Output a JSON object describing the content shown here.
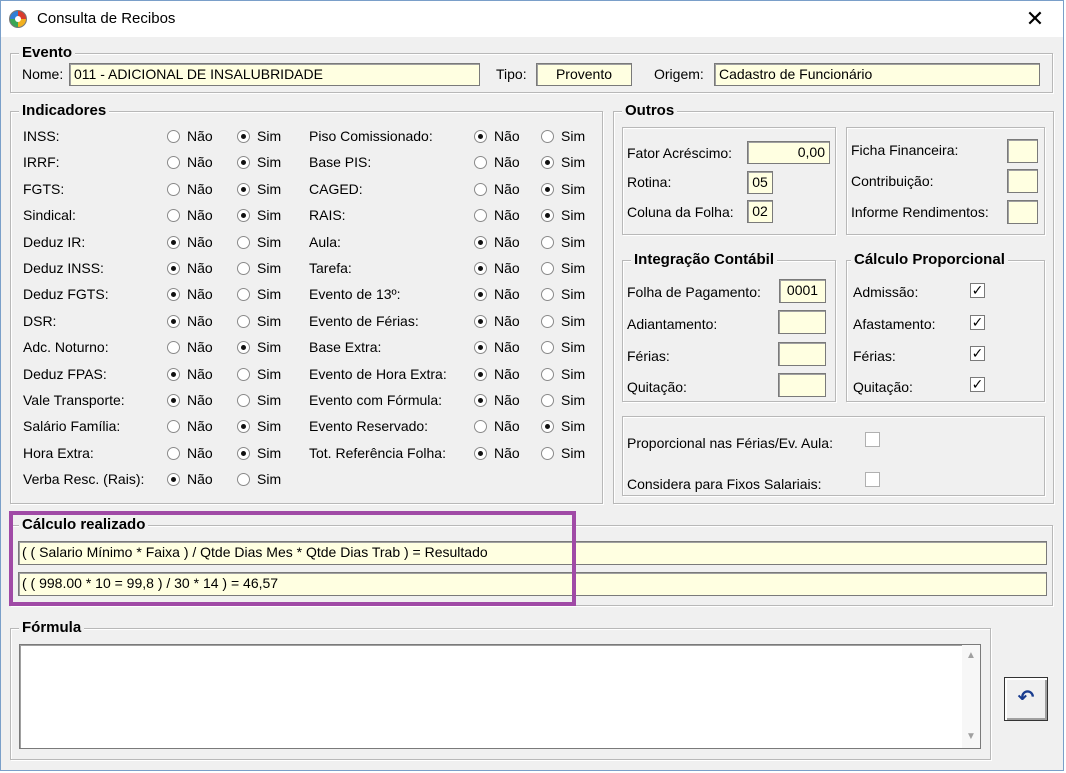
{
  "window": {
    "title": "Consulta de Recibos",
    "close_label": "✕"
  },
  "evento": {
    "legend": "Evento",
    "nome_label": "Nome:",
    "nome_value": "011 - ADICIONAL DE INSALUBRIDADE",
    "tipo_label": "Tipo:",
    "tipo_value": "Provento",
    "origem_label": "Origem:",
    "origem_value": "Cadastro de Funcionário"
  },
  "indicadores": {
    "legend": "Indicadores",
    "nao": "Não",
    "sim": "Sim",
    "left": [
      {
        "label": "INSS:",
        "value": "sim"
      },
      {
        "label": "IRRF:",
        "value": "sim"
      },
      {
        "label": "FGTS:",
        "value": "sim"
      },
      {
        "label": "Sindical:",
        "value": "sim"
      },
      {
        "label": "Deduz IR:",
        "value": "nao"
      },
      {
        "label": "Deduz INSS:",
        "value": "nao"
      },
      {
        "label": "Deduz FGTS:",
        "value": "nao"
      },
      {
        "label": "DSR:",
        "value": "nao"
      },
      {
        "label": "Adc. Noturno:",
        "value": "sim"
      },
      {
        "label": "Deduz FPAS:",
        "value": "nao"
      },
      {
        "label": "Vale Transporte:",
        "value": "nao"
      },
      {
        "label": "Salário Família:",
        "value": "sim"
      },
      {
        "label": "Hora Extra:",
        "value": "sim"
      },
      {
        "label": "Verba Resc. (Rais):",
        "value": "nao"
      }
    ],
    "right": [
      {
        "label": "Piso Comissionado:",
        "value": "nao"
      },
      {
        "label": "Base PIS:",
        "value": "sim"
      },
      {
        "label": "CAGED:",
        "value": "sim"
      },
      {
        "label": "RAIS:",
        "value": "sim"
      },
      {
        "label": "Aula:",
        "value": "nao"
      },
      {
        "label": "Tarefa:",
        "value": "nao"
      },
      {
        "label": "Evento de 13º:",
        "value": "nao"
      },
      {
        "label": "Evento de Férias:",
        "value": "nao"
      },
      {
        "label": "Base Extra:",
        "value": "nao"
      },
      {
        "label": "Evento de Hora Extra:",
        "value": "nao"
      },
      {
        "label": "Evento com Fórmula:",
        "value": "nao"
      },
      {
        "label": "Evento Reservado:",
        "value": "sim"
      },
      {
        "label": "Tot. Referência Folha:",
        "value": "nao"
      }
    ]
  },
  "outros": {
    "legend": "Outros",
    "fator_label": "Fator Acréscimo:",
    "fator_value": "0,00",
    "rotina_label": "Rotina:",
    "rotina_value": "05",
    "coluna_label": "Coluna da Folha:",
    "coluna_value": "02",
    "ficha_label": "Ficha Financeira:",
    "ficha_value": "",
    "contrib_label": "Contribuição:",
    "contrib_value": "",
    "informe_label": "Informe Rendimentos:",
    "informe_value": ""
  },
  "integracao": {
    "legend": "Integração Contábil",
    "folha_label": "Folha de Pagamento:",
    "folha_value": "0001",
    "adiant_label": "Adiantamento:",
    "adiant_value": "",
    "ferias_label": "Férias:",
    "ferias_value": "",
    "quit_label": "Quitação:",
    "quit_value": ""
  },
  "proporcional": {
    "legend": "Cálculo Proporcional",
    "admissao_label": "Admissão:",
    "admissao_checked": true,
    "afast_label": "Afastamento:",
    "afast_checked": true,
    "ferias_label": "Férias:",
    "ferias_checked": true,
    "quit_label": "Quitação:",
    "quit_checked": true,
    "check_mark": "✓"
  },
  "flags": {
    "prop_ferias_label": "Proporcional nas Férias/Ev. Aula:",
    "prop_ferias_checked": false,
    "fixos_label": "Considera para Fixos Salariais:",
    "fixos_checked": false
  },
  "calculo": {
    "legend": "Cálculo realizado",
    "line1": "( ( Salario Mínimo * Faixa ) / Qtde Dias Mes * Qtde Dias Trab )  = Resultado",
    "line2": "( ( 998.00      * 10 = 99,8 ) / 30 * 14 ) = 46,57"
  },
  "formula": {
    "legend": "Fórmula",
    "value": ""
  },
  "undo_button": {
    "icon": "undo-icon",
    "glyph": "↶"
  },
  "colors": {
    "field_bg": "#ffffe1",
    "highlight": "#a04aa6",
    "window_bg": "#f0f0f0"
  }
}
